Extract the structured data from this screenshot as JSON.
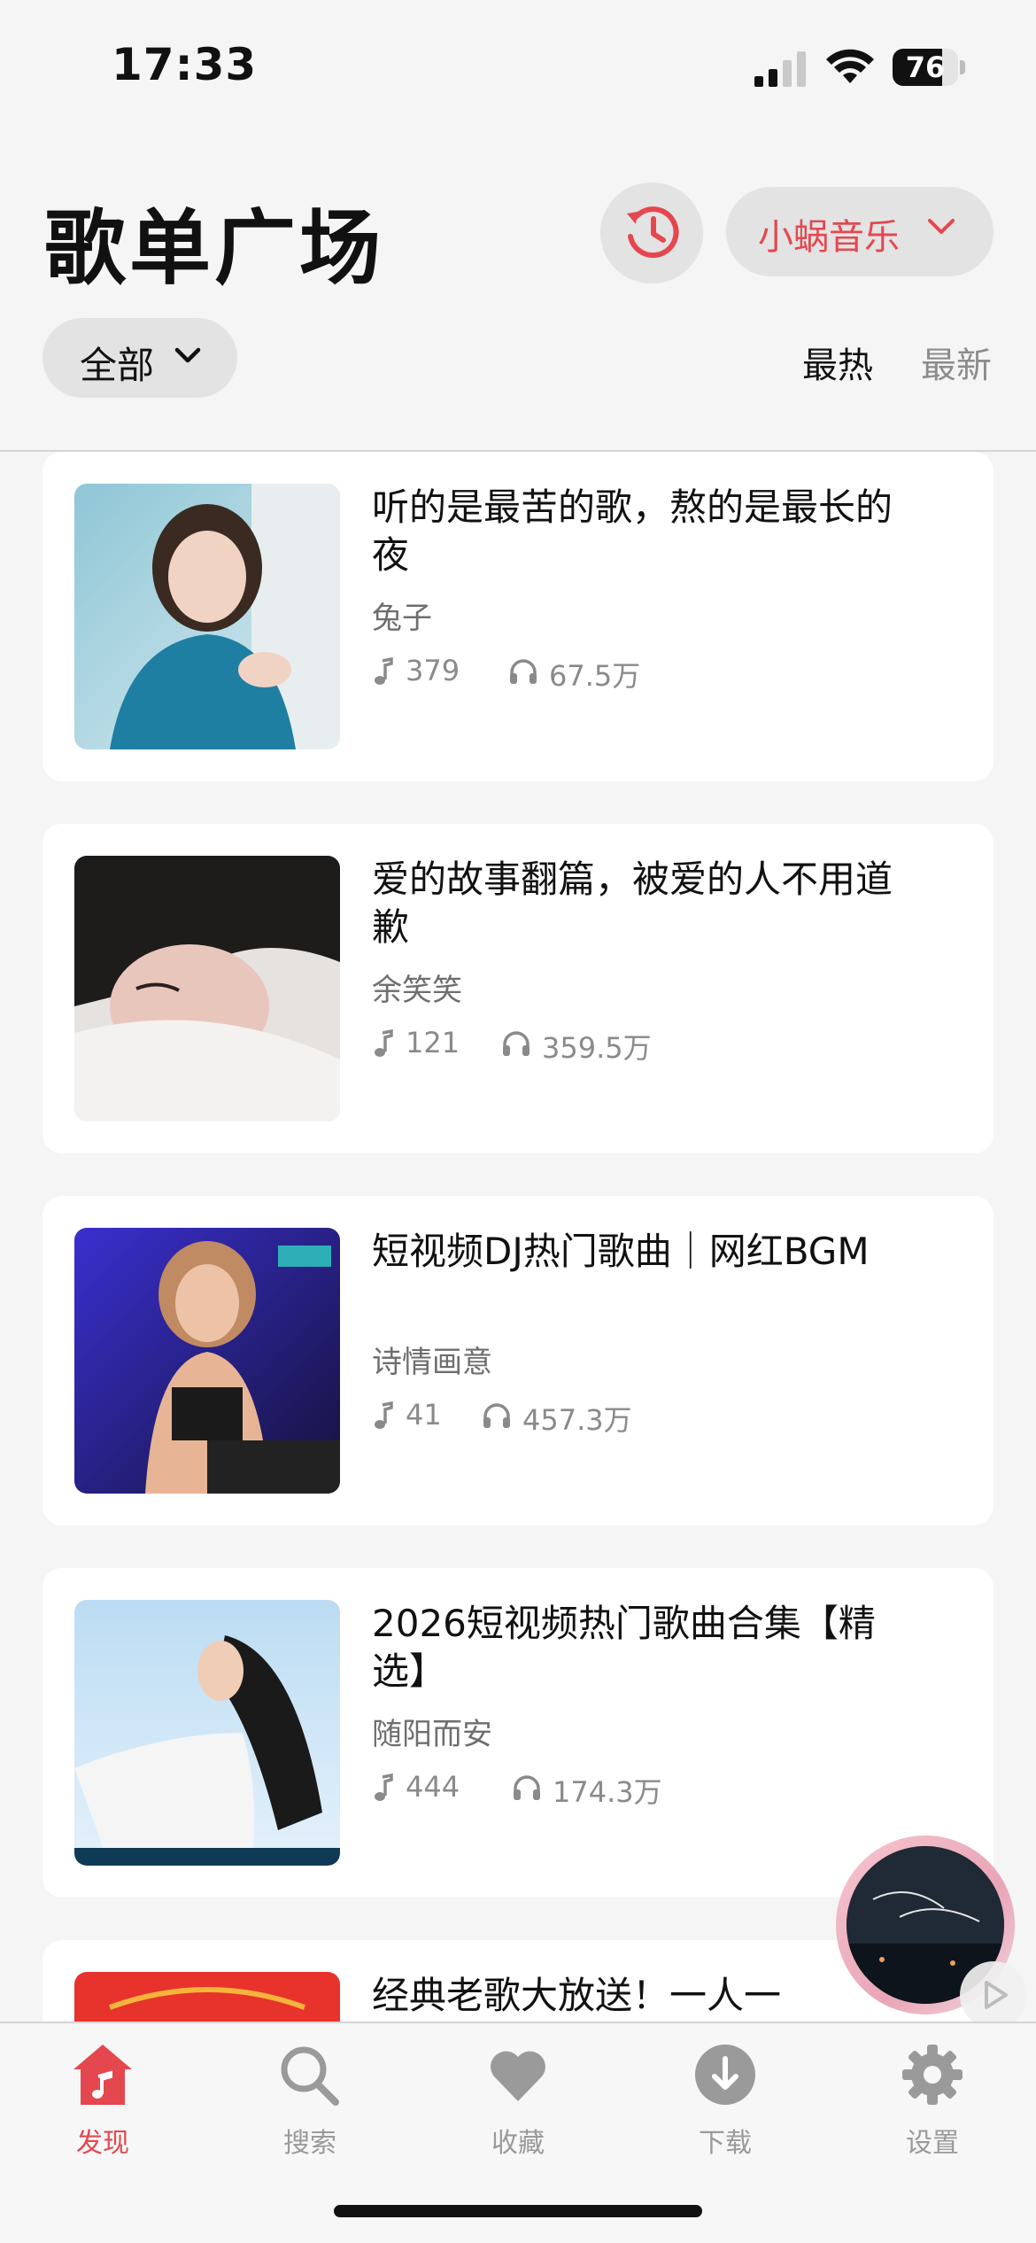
{
  "status_bar": {
    "time": "17:33",
    "battery": "76",
    "battery_level": 0.76
  },
  "header": {
    "title": "歌单广场",
    "history_icon": "history-icon",
    "source_label": "小蜗音乐",
    "filter_label": "全部",
    "sort_hot": "最热",
    "sort_new": "最新",
    "accent_color": "#e5474f"
  },
  "playlists": [
    {
      "title": "听的是最苦的歌，熬的是最长的夜",
      "author": "兔子",
      "songs": "379",
      "plays": "67.5万"
    },
    {
      "title": "爱的故事翻篇，被爱的人不用道歉",
      "author": "余笑笑",
      "songs": "121",
      "plays": "359.5万"
    },
    {
      "title": "短视频DJ热门歌曲｜网红BGM",
      "author": "诗情画意",
      "songs": "41",
      "plays": "457.3万"
    },
    {
      "title": "2026短视频热门歌曲合集【精选】",
      "author": "随阳而安",
      "songs": "444",
      "plays": "174.3万"
    },
    {
      "title": "经典老歌大放送！一人一",
      "author": "",
      "songs": "",
      "plays": ""
    }
  ],
  "tabs": [
    {
      "label": "发现",
      "icon": "home-music-icon",
      "active": true
    },
    {
      "label": "搜索",
      "icon": "search-icon",
      "active": false
    },
    {
      "label": "收藏",
      "icon": "heart-icon",
      "active": false
    },
    {
      "label": "下载",
      "icon": "download-icon",
      "active": false
    },
    {
      "label": "设置",
      "icon": "gear-icon",
      "active": false
    }
  ]
}
